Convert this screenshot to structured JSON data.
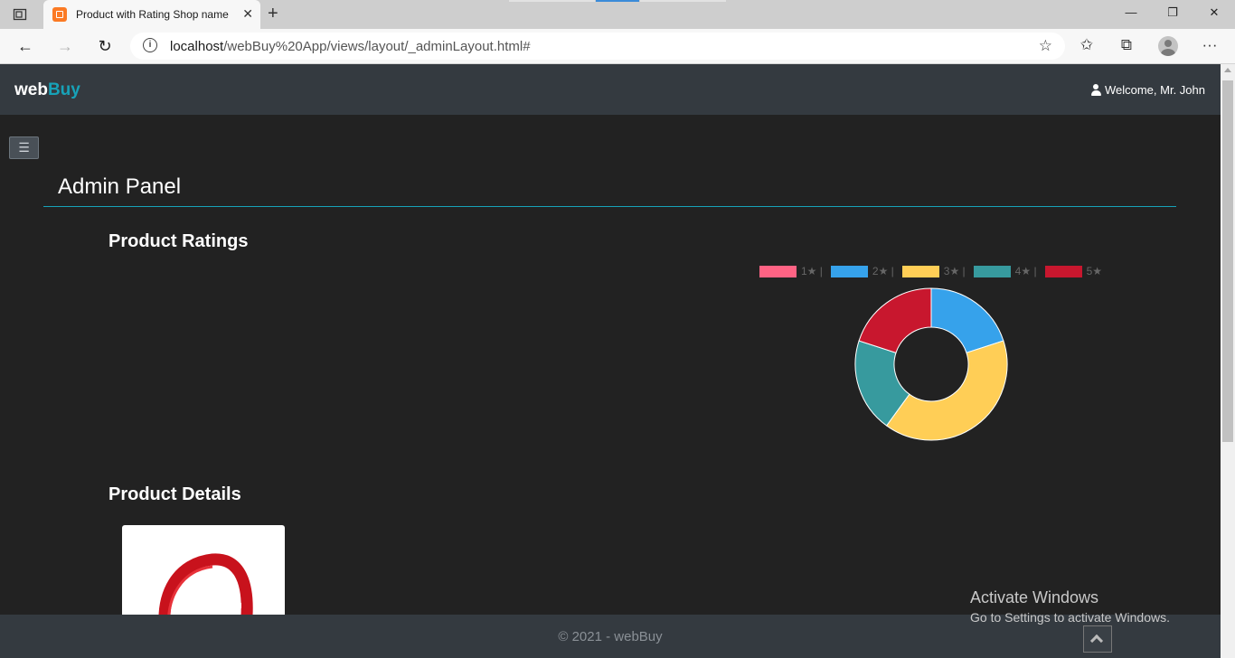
{
  "browser": {
    "tab_title": "Product with Rating Shop name",
    "url_host": "localhost",
    "url_path": "/webBuy%20App/views/layout/_adminLayout.html#"
  },
  "navbar": {
    "brand_main": "web",
    "brand_accent": "Buy",
    "welcome": "Welcome, Mr. John"
  },
  "main": {
    "panel_title": "Admin Panel",
    "ratings_title": "Product Ratings",
    "details_title": "Product Details"
  },
  "chart_data": {
    "type": "pie",
    "subtype": "doughnut",
    "categories": [
      "1★ |",
      "2★ |",
      "3★ |",
      "4★ |",
      "5★"
    ],
    "values": [
      0,
      1,
      2,
      1,
      1
    ],
    "colors": [
      "#ff6384",
      "#36a2eb",
      "#ffce56",
      "#379a9e",
      "#c8172e"
    ],
    "legend": "top"
  },
  "footer": {
    "copyright": "© 2021 - webBuy"
  },
  "watermark": {
    "line1": "Activate Windows",
    "line2": "Go to Settings to activate Windows."
  },
  "colors": {
    "accent": "#17a2b8",
    "navbar": "#343a40",
    "page_bg": "#222222"
  }
}
